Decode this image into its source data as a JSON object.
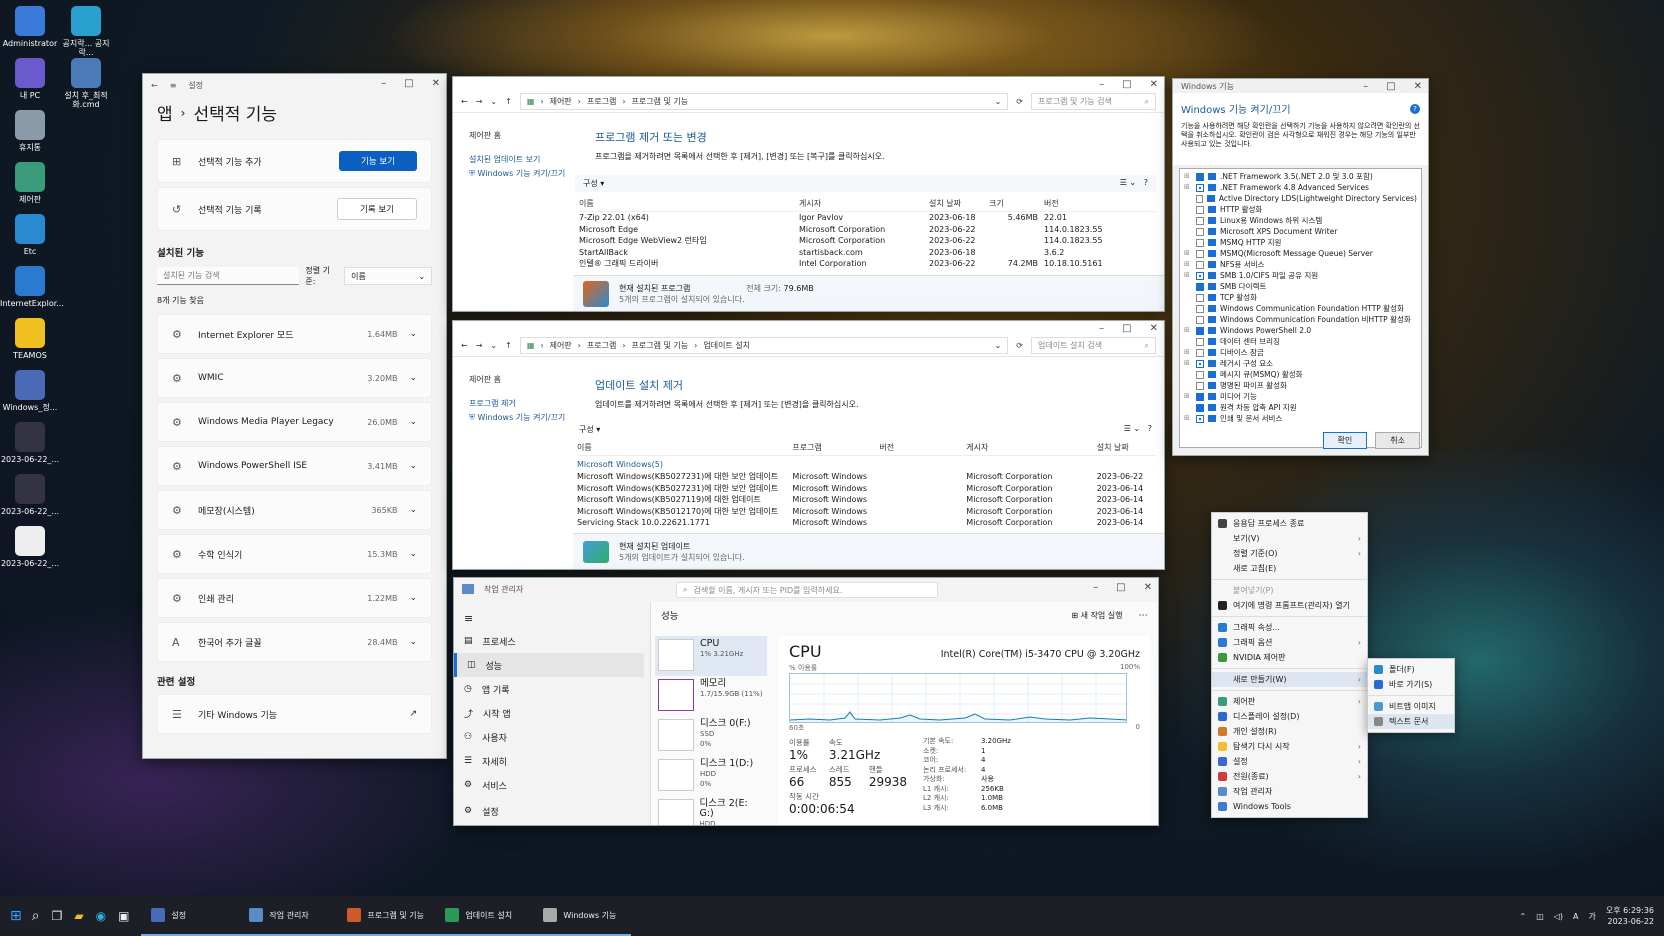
{
  "desktop": {
    "icons": [
      "Administrator",
      "공지락... 공지락...",
      "내 PC",
      "설치 후_최적화.cmd",
      "휴지통",
      "제어판",
      "Etc",
      "InternetExplor...",
      "TEAMOS",
      "Windows_정...",
      "2023-06-22_...",
      "2023-06-22_...",
      "2023-06-22_..."
    ]
  },
  "settings": {
    "title": "설정",
    "crumb_app": "앱",
    "crumb_sep": "›",
    "page_title": "선택적 기능",
    "add_label": "선택적 기능 추가",
    "add_btn": "기능 보기",
    "history_label": "선택적 기능 기록",
    "history_btn": "기록 보기",
    "installed_header": "설치된 기능",
    "search_placeholder": "설치된 기능 검색",
    "sort_label": "정렬 기준:",
    "sort_value": "이름",
    "count": "8개 기능 찾음",
    "features": [
      {
        "name": "Internet Explorer 모드",
        "size": "1.64MB"
      },
      {
        "name": "WMIC",
        "size": "3.20MB"
      },
      {
        "name": "Windows Media Player Legacy",
        "size": "26.0MB"
      },
      {
        "name": "Windows PowerShell ISE",
        "size": "3.41MB"
      },
      {
        "name": "메모장(시스템)",
        "size": "365KB"
      },
      {
        "name": "수학 인식기",
        "size": "15.3MB"
      },
      {
        "name": "인쇄 관리",
        "size": "1.22MB"
      },
      {
        "name": "한국어 추가 글꼴",
        "size": "28.4MB"
      }
    ],
    "related_header": "관련 설정",
    "related_item": "기타 Windows 기능"
  },
  "programs": {
    "crumbs": [
      "제어판",
      "프로그램",
      "프로그램 및 기능"
    ],
    "search_placeholder": "프로그램 및 기능 검색",
    "side_home": "제어판 홈",
    "side_updates": "설치된 업데이트 보기",
    "side_features": "Windows 기능 켜기/끄기",
    "title": "프로그램 제거 또는 변경",
    "desc": "프로그램을 제거하려면 목록에서 선택한 후 [제거], [변경] 또는 [복구]를 클릭하십시오.",
    "organize": "구성 ▾",
    "cols": [
      "이름",
      "게시자",
      "설치 날짜",
      "크기",
      "버전"
    ],
    "rows": [
      [
        "7-Zip 22.01 (x64)",
        "Igor Pavlov",
        "2023-06-18",
        "5.46MB",
        "22.01"
      ],
      [
        "Microsoft Edge",
        "Microsoft Corporation",
        "2023-06-22",
        "",
        "114.0.1823.55"
      ],
      [
        "Microsoft Edge WebView2 런타임",
        "Microsoft Corporation",
        "2023-06-22",
        "",
        "114.0.1823.55"
      ],
      [
        "StartAllBack",
        "startisback.com",
        "2023-06-18",
        "",
        "3.6.2"
      ],
      [
        "인텔® 그래픽 드라이버",
        "Intel Corporation",
        "2023-06-22",
        "74.2MB",
        "10.18.10.5161"
      ]
    ],
    "footer_title": "현재 설치된 프로그램",
    "footer_total_label": "전체 크기:",
    "footer_total": "79.6MB",
    "footer_sub": "5개의 프로그램이 설치되어 있습니다."
  },
  "updates": {
    "crumbs": [
      "제어판",
      "프로그램",
      "프로그램 및 기능",
      "업데이트 설치"
    ],
    "search_placeholder": "업데이트 설치 검색",
    "side_home": "제어판 홈",
    "side_remove": "프로그램 제거",
    "side_features": "Windows 기능 켜기/끄기",
    "title": "업데이트 설치 제거",
    "desc": "업데이트를 제거하려면 목록에서 선택한 후 [제거] 또는 [변경]을 클릭하십시오.",
    "organize": "구성 ▾",
    "cols": [
      "이름",
      "프로그램",
      "버전",
      "게시자",
      "설치 날짜"
    ],
    "group": "Microsoft Windows(5)",
    "rows": [
      [
        "Microsoft Windows(KB5027231)에 대한 보안 업데이트",
        "Microsoft Windows",
        "",
        "Microsoft Corporation",
        "2023-06-22"
      ],
      [
        "Microsoft Windows(KB5027231)에 대한 보안 업데이트",
        "Microsoft Windows",
        "",
        "Microsoft Corporation",
        "2023-06-14"
      ],
      [
        "Microsoft Windows(KB5027119)에 대한 업데이트",
        "Microsoft Windows",
        "",
        "Microsoft Corporation",
        "2023-06-14"
      ],
      [
        "Microsoft Windows(KB5012170)에 대한 보안 업데이트",
        "Microsoft Windows",
        "",
        "Microsoft Corporation",
        "2023-06-14"
      ],
      [
        "Servicing Stack 10.0.22621.1771",
        "Microsoft Windows",
        "",
        "Microsoft Corporation",
        "2023-06-14"
      ]
    ],
    "footer_title": "현재 설치된 업데이트",
    "footer_sub": "5개의 업데이트가 설치되어 있습니다."
  },
  "winfeatures": {
    "title": "Windows 기능",
    "heading": "Windows 기능 켜기/끄기",
    "desc": "기능을 사용하려면 해당 확인란을 선택하기 기능을 사용하지 않으려면 확인란의 선택을 취소하십시오. 확인란이 검은 사각형으로 채워진 경우는 해당 기능의 일부만 사용되고 있는 것입니다.",
    "items": [
      {
        "label": ".NET Framework 3.5(.NET 2.0 및 3.0 포함)",
        "state": "on",
        "exp": true
      },
      {
        "label": ".NET Framework 4.8 Advanced Services",
        "state": "part",
        "exp": true
      },
      {
        "label": "Active Directory LDS(Lightweight Directory Services)",
        "state": "off",
        "exp": false
      },
      {
        "label": "HTTP 활성화",
        "state": "off",
        "exp": false
      },
      {
        "label": "Linux용 Windows 하위 시스템",
        "state": "off",
        "exp": false
      },
      {
        "label": "Microsoft XPS Document Writer",
        "state": "off",
        "exp": false
      },
      {
        "label": "MSMQ HTTP 지원",
        "state": "off",
        "exp": false
      },
      {
        "label": "MSMQ(Microsoft Message Queue) Server",
        "state": "off",
        "exp": true
      },
      {
        "label": "NFS용 서비스",
        "state": "off",
        "exp": true
      },
      {
        "label": "SMB 1.0/CIFS 파일 공유 지원",
        "state": "part",
        "exp": true
      },
      {
        "label": "SMB 다이렉트",
        "state": "on",
        "exp": false
      },
      {
        "label": "TCP 활성화",
        "state": "off",
        "exp": false
      },
      {
        "label": "Windows Communication Foundation HTTP 활성화",
        "state": "off",
        "exp": false
      },
      {
        "label": "Windows Communication Foundation 비HTTP 활성화",
        "state": "off",
        "exp": false
      },
      {
        "label": "Windows PowerShell 2.0",
        "state": "on",
        "exp": true
      },
      {
        "label": "데이터 센터 브리징",
        "state": "off",
        "exp": false
      },
      {
        "label": "디바이스 잠금",
        "state": "off",
        "exp": true
      },
      {
        "label": "레거시 구성 요소",
        "state": "part",
        "exp": true
      },
      {
        "label": "메시지 큐(MSMQ) 활성화",
        "state": "off",
        "exp": false
      },
      {
        "label": "명명된 파이프 활성화",
        "state": "off",
        "exp": false
      },
      {
        "label": "미디어 기능",
        "state": "on",
        "exp": true
      },
      {
        "label": "원격 차등 압축 API 지원",
        "state": "on",
        "exp": false
      },
      {
        "label": "인쇄 및 문서 서비스",
        "state": "part",
        "exp": true
      }
    ],
    "ok": "확인",
    "cancel": "취소"
  },
  "taskmgr": {
    "title": "작업 관리자",
    "search_placeholder": "검색할 이름, 게시자 또는 PID를 입력하세요.",
    "section": "성능",
    "new_task": "새 작업 실행",
    "nav": [
      "프로세스",
      "성능",
      "앱 기록",
      "시작 앱",
      "사용자",
      "자세히",
      "서비스",
      "설정"
    ],
    "tiles": [
      {
        "name": "CPU",
        "sub": "1% 3.21GHz",
        "sub2": ""
      },
      {
        "name": "메모리",
        "sub": "1.7/15.9GB (11%)",
        "sub2": ""
      },
      {
        "name": "디스크 0(F:)",
        "sub": "SSD",
        "sub2": "0%"
      },
      {
        "name": "디스크 1(D:)",
        "sub": "HDD",
        "sub2": "0%"
      },
      {
        "name": "디스크 2(E: G:)",
        "sub": "HDD",
        "sub2": "0%"
      }
    ],
    "cpu_title": "CPU",
    "cpu_model": "Intel(R) Core(TM) i5-3470 CPU @ 3.20GHz",
    "graph_label": "% 이용률",
    "graph_max": "100%",
    "graph_min_time": "60초",
    "graph_zero": "0",
    "usage_l": "이용률",
    "usage_v": "1%",
    "speed_l": "속도",
    "speed_v": "3.21GHz",
    "proc_l": "프로세스",
    "proc_v": "66",
    "thread_l": "스레드",
    "thread_v": "855",
    "handle_l": "핸들",
    "handle_v": "29938",
    "uptime_l": "작동 시간",
    "uptime_v": "0:00:06:54",
    "specs": [
      [
        "기본 속도:",
        "3.20GHz"
      ],
      [
        "소켓:",
        "1"
      ],
      [
        "코어:",
        "4"
      ],
      [
        "논리 프로세서:",
        "4"
      ],
      [
        "가상화:",
        "사용"
      ],
      [
        "L1 캐시:",
        "256KB"
      ],
      [
        "L2 캐시:",
        "1.0MB"
      ],
      [
        "L3 캐시:",
        "6.0MB"
      ]
    ]
  },
  "context_menu": {
    "items": [
      {
        "label": "응용답 프로세스 종료",
        "arrow": false,
        "dis": false,
        "sep": false
      },
      {
        "label": "보기(V)",
        "arrow": true,
        "dis": false,
        "sep": false
      },
      {
        "label": "정렬 기준(O)",
        "arrow": true,
        "dis": false,
        "sep": false
      },
      {
        "label": "새로 고침(E)",
        "arrow": false,
        "dis": false,
        "sep": true
      },
      {
        "label": "붙여넣기(P)",
        "arrow": false,
        "dis": true,
        "sep": false
      },
      {
        "label": "여기에 명령 프롬프트(관리자) 열기",
        "arrow": false,
        "dis": false,
        "sep": true
      },
      {
        "label": "그래픽 속성...",
        "arrow": false,
        "dis": false,
        "sep": false
      },
      {
        "label": "그래픽 옵션",
        "arrow": true,
        "dis": false,
        "sep": false
      },
      {
        "label": "NVIDIA 제어판",
        "arrow": false,
        "dis": false,
        "sep": true
      },
      {
        "label": "새로 만들기(W)",
        "arrow": true,
        "dis": false,
        "sep": true
      },
      {
        "label": "제어판",
        "arrow": true,
        "dis": false,
        "sep": false
      },
      {
        "label": "디스플레이 설정(D)",
        "arrow": false,
        "dis": false,
        "sep": false
      },
      {
        "label": "개인 설정(R)",
        "arrow": false,
        "dis": false,
        "sep": false
      },
      {
        "label": "탐색기 다시 시작",
        "arrow": true,
        "dis": false,
        "sep": false
      },
      {
        "label": "설정",
        "arrow": true,
        "dis": false,
        "sep": false
      },
      {
        "label": "전원(종료)",
        "arrow": true,
        "dis": false,
        "sep": false
      },
      {
        "label": "작업 관리자",
        "arrow": false,
        "dis": false,
        "sep": false
      },
      {
        "label": "Windows Tools",
        "arrow": false,
        "dis": false,
        "sep": false
      }
    ],
    "submenu": [
      "폴더(F)",
      "바로 가기(S)",
      "비트맵 이미지",
      "텍스트 문서"
    ]
  },
  "taskbar": {
    "apps": [
      "설정",
      "작업 관리자",
      "프로그램 및 기능",
      "업데이트 설치",
      "Windows 기능"
    ],
    "lang": "A",
    "time": "오후 6:29:36",
    "date": "2023-06-22"
  }
}
